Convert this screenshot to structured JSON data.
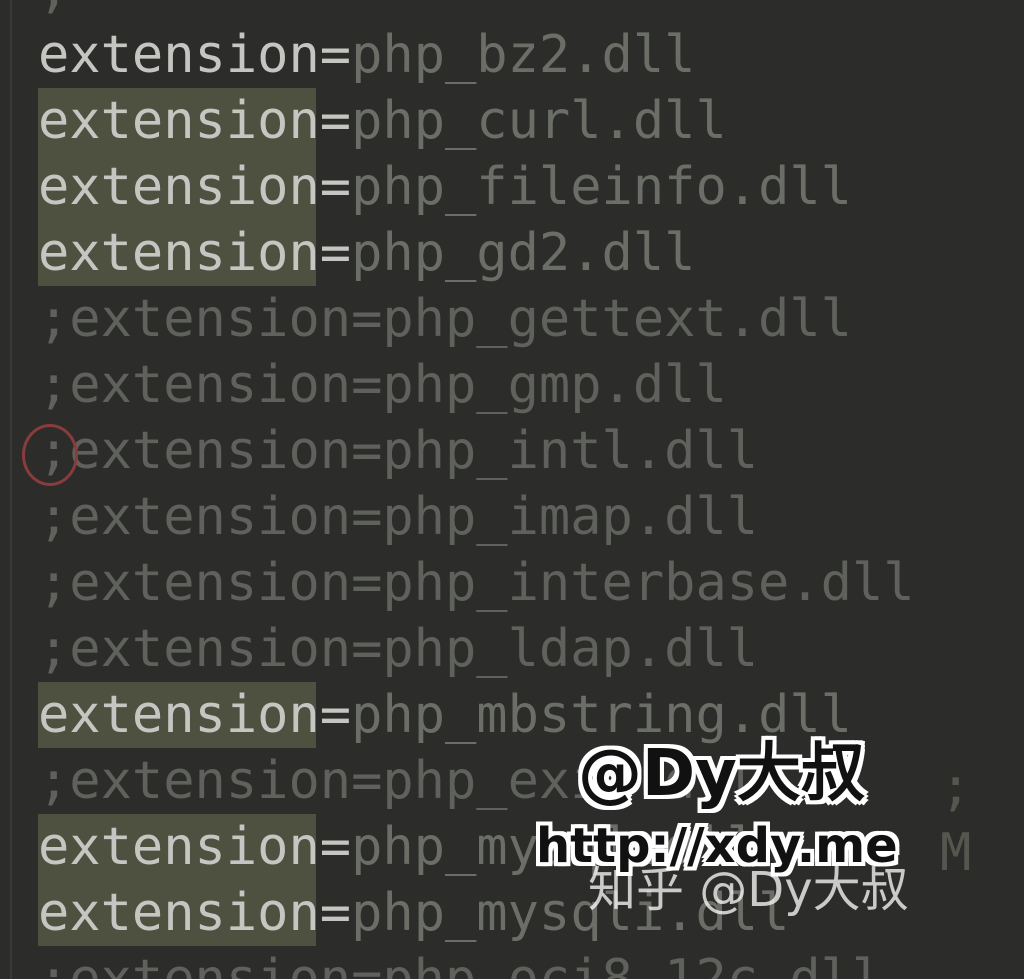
{
  "editor": {
    "top_partial": ";",
    "lines": [
      {
        "commented": false,
        "highlighted": false,
        "key": "extension",
        "eq": "=",
        "value": "php_bz2.dll"
      },
      {
        "commented": false,
        "highlighted": true,
        "key": "extension",
        "eq": "=",
        "value": "php_curl.dll"
      },
      {
        "commented": false,
        "highlighted": true,
        "key": "extension",
        "eq": "=",
        "value": "php_fileinfo.dll"
      },
      {
        "commented": false,
        "highlighted": true,
        "key": "extension",
        "eq": "=",
        "value": "php_gd2.dll"
      },
      {
        "commented": true,
        "highlighted": false,
        "text": ";extension=php_gettext.dll"
      },
      {
        "commented": true,
        "highlighted": false,
        "text": ";extension=php_gmp.dll"
      },
      {
        "commented": true,
        "highlighted": false,
        "text": ";extension=php_intl.dll"
      },
      {
        "commented": true,
        "highlighted": false,
        "text": ";extension=php_imap.dll"
      },
      {
        "commented": true,
        "highlighted": false,
        "text": ";extension=php_interbase.dll"
      },
      {
        "commented": true,
        "highlighted": false,
        "text": ";extension=php_ldap.dll"
      },
      {
        "commented": false,
        "highlighted": true,
        "key": "extension",
        "eq": "=",
        "value": "php_mbstring.dll"
      },
      {
        "commented": true,
        "highlighted": false,
        "text": ";extension=php_exif.dll"
      },
      {
        "commented": false,
        "highlighted": true,
        "key": "extension",
        "eq": "=",
        "value": "php_mysql.dll"
      },
      {
        "commented": false,
        "highlighted": true,
        "key": "extension",
        "eq": "=",
        "value": "php_mysqli.dll"
      }
    ],
    "right_fragment": "; M",
    "bottom_partial": ";extension=php_oci8_12c.dll"
  },
  "watermark": {
    "handle": "@Dy大叔",
    "url": "http://xdy.me",
    "zhihu": "知乎 @Dy大叔"
  },
  "colors": {
    "background": "#2c2d2b",
    "highlight": "#4e5040",
    "key": "#c5c6c2",
    "value": "#6b6d67",
    "comment": "#5f615c",
    "cursor_circle": "#8a3b3b"
  }
}
